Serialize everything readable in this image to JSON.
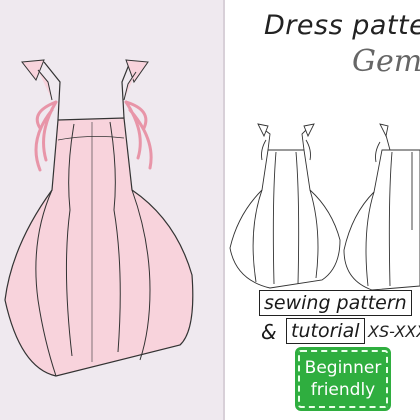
{
  "header": {
    "title": "Dress patter",
    "subtitle": "Gem"
  },
  "tags": {
    "sewing_pattern": "sewing pattern",
    "ampersand": "&",
    "tutorial": "tutorial",
    "sizes": "XS-XXX"
  },
  "badge": {
    "line1": "Beginner",
    "line2": "friendly"
  },
  "colors": {
    "background_left": "#efe9ef",
    "dress_fill": "#f8d3dc",
    "ties": "#e895a8",
    "badge": "#2fae3f",
    "line_art": "#333333"
  }
}
